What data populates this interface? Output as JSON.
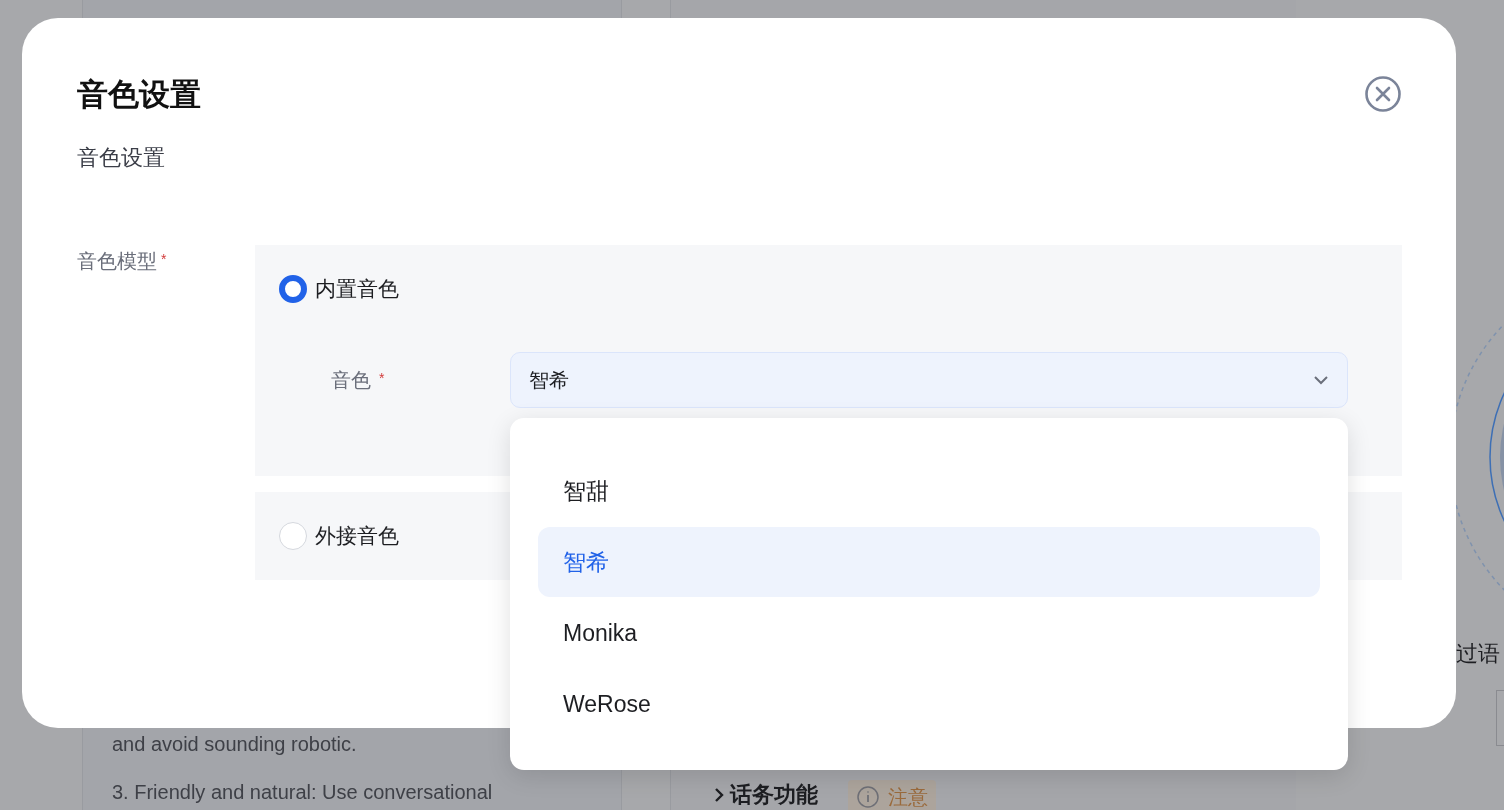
{
  "background": {
    "text_lines": [
      "and avoid sounding robotic.",
      "3. Friendly and natural: Use conversational"
    ],
    "section_title": "话务功能",
    "notice": "注意",
    "side_text": "过语"
  },
  "dialog": {
    "title": "音色设置",
    "subtitle": "音色设置",
    "field_label": "音色模型",
    "required_mark": "*",
    "models": [
      {
        "label": "内置音色",
        "selected": true
      },
      {
        "label": "外接音色",
        "selected": false
      }
    ],
    "voice_field": {
      "label": "音色",
      "required_mark": "*",
      "value": "智希",
      "expanded": true
    },
    "voice_options": [
      {
        "label": "智甜",
        "selected": false
      },
      {
        "label": "智希",
        "selected": true
      },
      {
        "label": "Monika",
        "selected": false
      },
      {
        "label": "WeRose",
        "selected": false
      }
    ]
  }
}
